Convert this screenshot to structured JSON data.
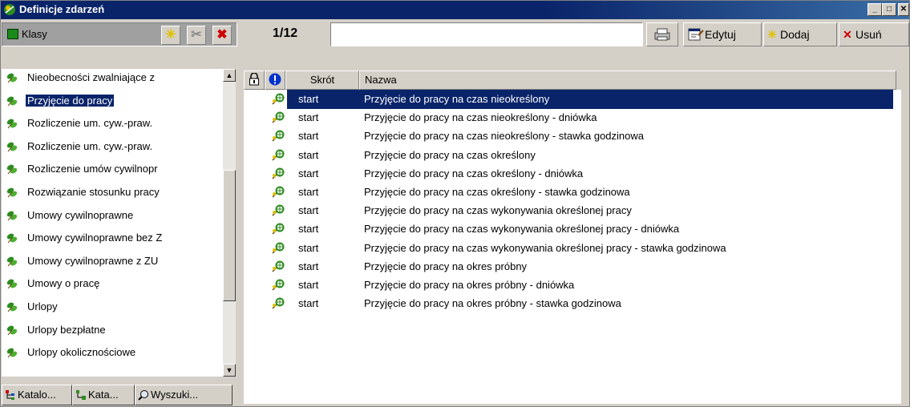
{
  "window": {
    "title": "Definicje zdarzeń",
    "minimize": "_",
    "maximize": "□",
    "close": "✕",
    "colors": {
      "titlebar": "#0a246a",
      "selection": "#0a246a",
      "face": "#d4d0c8",
      "leaf": "#2e8b20"
    }
  },
  "left_panel": {
    "header_label": "Klasy",
    "buttons": [
      {
        "name": "add",
        "glyph": "✳",
        "color": "#e0c000"
      },
      {
        "name": "edit",
        "glyph": "✂",
        "color": "#8a8a8a"
      },
      {
        "name": "delete",
        "glyph": "✖",
        "color": "#cc0000"
      }
    ],
    "items": [
      "Nieobecności zwalniające z",
      "Przyjęcie do pracy",
      "Rozliczenie um. cyw.-praw.",
      "Rozliczenie um. cyw.-praw.",
      "Rozliczenie umów cywilnopr",
      "Rozwiązanie stosunku pracy",
      "Umowy cywilnoprawne",
      "Umowy cywilnoprawne bez Z",
      "Umowy cywilnoprawne z ZU",
      "Umowy o pracę",
      "Urlopy",
      "Urlopy bezpłatne",
      "Urlopy okolicznościowe"
    ],
    "selected_index": 1,
    "tabs": [
      "Katalo...",
      "Kata...",
      "Wyszuki..."
    ]
  },
  "toolbar": {
    "counter": "1/12",
    "search_value": "",
    "edit_label": "Edytuj",
    "add_label": "Dodaj",
    "delete_label": "Usuń"
  },
  "grid": {
    "columns": {
      "lock": "lock-icon",
      "alert": "alert-icon",
      "short": "Skrót",
      "name": "Nazwa"
    },
    "rows": [
      {
        "short": "start",
        "name": "Przyjęcie do pracy na czas nieokreślony"
      },
      {
        "short": "start",
        "name": "Przyjęcie do pracy na czas nieokreślony - dniówka"
      },
      {
        "short": "start",
        "name": "Przyjęcie do pracy na czas nieokreślony - stawka godzinowa"
      },
      {
        "short": "start",
        "name": "Przyjęcie do pracy na czas określony"
      },
      {
        "short": "start",
        "name": "Przyjęcie do pracy na czas określony - dniówka"
      },
      {
        "short": "start",
        "name": "Przyjęcie do pracy na czas określony - stawka godzinowa"
      },
      {
        "short": "start",
        "name": "Przyjęcie do pracy na czas wykonywania określonej pracy"
      },
      {
        "short": "start",
        "name": "Przyjęcie do pracy na czas wykonywania określonej pracy - dniówka"
      },
      {
        "short": "start",
        "name": "Przyjęcie do pracy na czas wykonywania określonej pracy - stawka godzinowa"
      },
      {
        "short": "start",
        "name": "Przyjęcie do pracy na okres próbny"
      },
      {
        "short": "start",
        "name": "Przyjęcie do pracy na okres próbny - dniówka"
      },
      {
        "short": "start",
        "name": "Przyjęcie do pracy na okres próbny - stawka godzinowa"
      }
    ],
    "selected_index": 0
  }
}
